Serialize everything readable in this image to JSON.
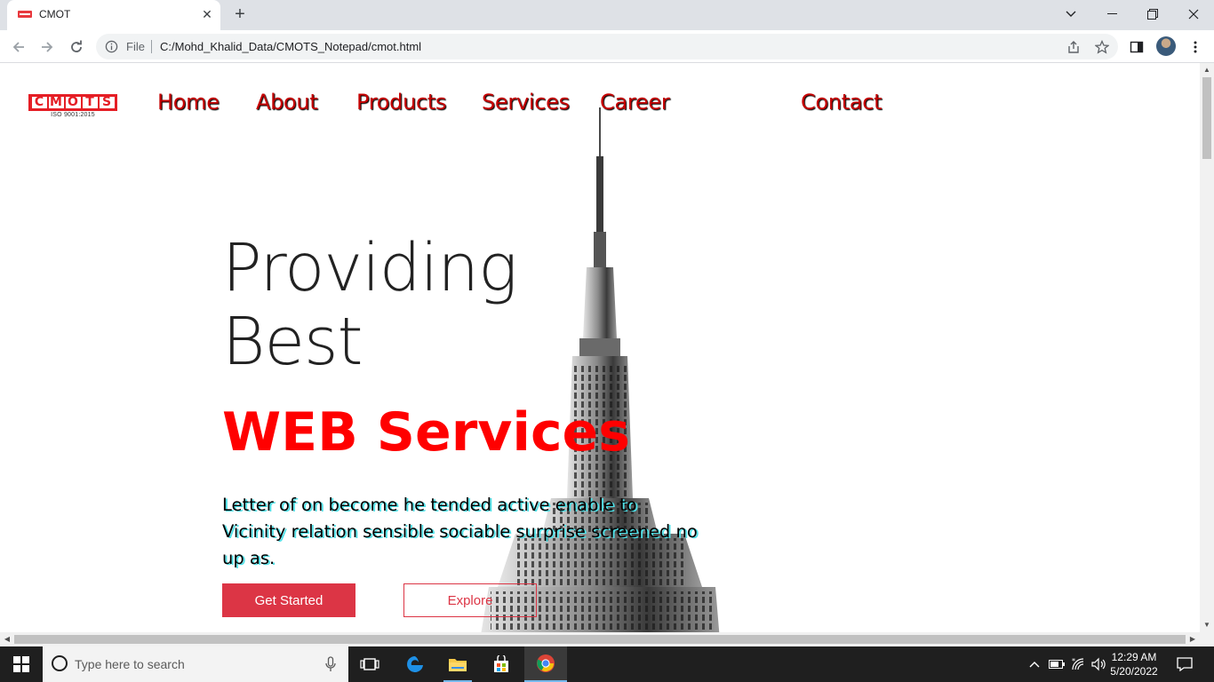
{
  "browser": {
    "tab": {
      "title": "CMOT",
      "favicon": "cmots-logo-icon"
    },
    "omnibox": {
      "scheme_label": "File",
      "url": "C:/Mohd_Khalid_Data/CMOTS_Notepad/cmot.html"
    }
  },
  "site": {
    "logo": {
      "letters": [
        "C",
        "M",
        "O",
        "T",
        "S"
      ],
      "tagline": "ISO 9001:2015",
      "color": "#e51e25"
    },
    "nav": [
      {
        "label": "Home"
      },
      {
        "label": "About"
      },
      {
        "label": "Products"
      },
      {
        "label": "Services"
      },
      {
        "label": "Career"
      },
      {
        "label": "Contact"
      }
    ],
    "hero": {
      "line1": "Providing",
      "line2": "Best",
      "accent": "WEB Services",
      "description": "Letter of on become he tended active enable to Vicinity relation sensible sociable surprise screened no up as.",
      "primary_button": "Get Started",
      "secondary_button": "Explore",
      "accent_color": "#ff0000",
      "button_color": "#dc3545"
    }
  },
  "taskbar": {
    "search_placeholder": "Type here to search",
    "pinned_apps": [
      "task-view-icon",
      "edge-icon",
      "file-explorer-icon",
      "store-icon",
      "chrome-icon"
    ],
    "clock": {
      "time": "12:29 AM",
      "date": "5/20/2022"
    }
  }
}
